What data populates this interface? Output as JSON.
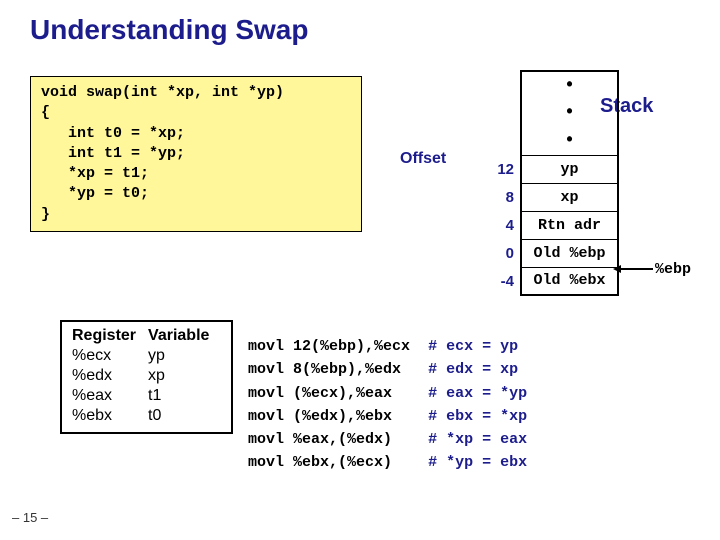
{
  "title": "Understanding Swap",
  "code": "void swap(int *xp, int *yp)\n{\n   int t0 = *xp;\n   int t1 = *yp;\n   *xp = t1;\n   *yp = t0;\n}",
  "regtable": {
    "h0": "Register",
    "h1": "Variable",
    "rows": [
      [
        "%ecx",
        "yp"
      ],
      [
        "%edx",
        "xp"
      ],
      [
        "%eax",
        "t1"
      ],
      [
        "%ebx",
        "t0"
      ]
    ]
  },
  "stack": {
    "label": "Stack",
    "offset_label": "Offset",
    "rows": [
      {
        "off": "",
        "val": "•",
        "spacer": true
      },
      {
        "off": "",
        "val": "•",
        "spacer": true
      },
      {
        "off": "",
        "val": "•",
        "spacer": true
      },
      {
        "off": "12",
        "val": "yp"
      },
      {
        "off": "8",
        "val": "xp"
      },
      {
        "off": "4",
        "val": "Rtn adr"
      },
      {
        "off": "0",
        "val": "Old %ebp"
      },
      {
        "off": "-4",
        "val": "Old %ebx"
      }
    ],
    "ebp": "%ebp"
  },
  "asm": [
    {
      "op": "movl",
      "arg": "12(%ebp),%ecx",
      "c": "# ecx = yp"
    },
    {
      "op": "movl",
      "arg": "8(%ebp),%edx",
      "c": "# edx = xp"
    },
    {
      "op": "movl",
      "arg": "(%ecx),%eax",
      "c": "# eax = *yp"
    },
    {
      "op": "movl",
      "arg": "(%edx),%ebx",
      "c": "# ebx = *xp"
    },
    {
      "op": "movl",
      "arg": "%eax,(%edx)",
      "c": "# *xp = eax"
    },
    {
      "op": "movl",
      "arg": "%ebx,(%ecx)",
      "c": "# *yp = ebx"
    }
  ],
  "footer": "– 15 –"
}
